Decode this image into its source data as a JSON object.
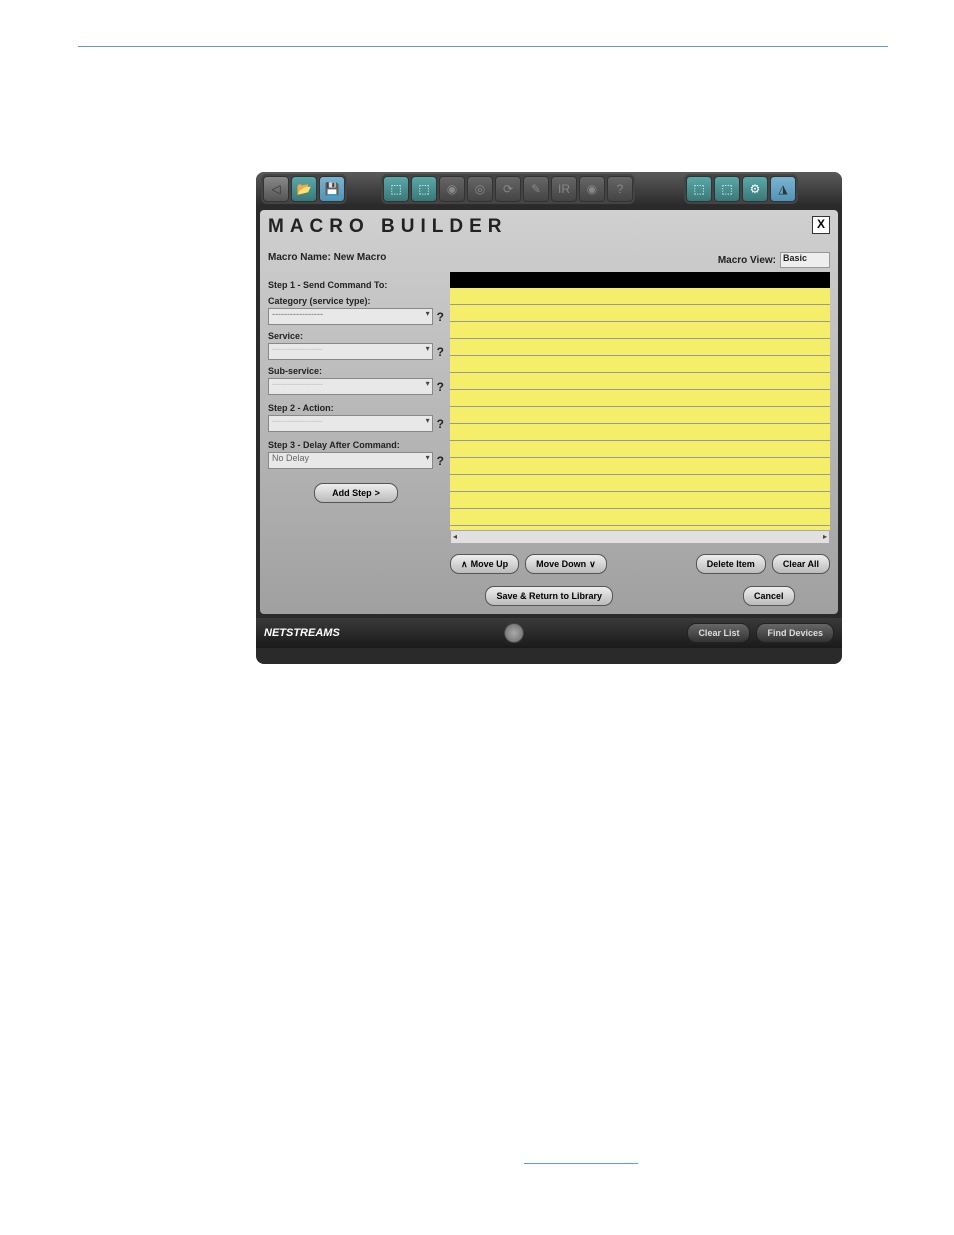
{
  "panel": {
    "title": "MACRO BUILDER",
    "close": "X",
    "macro_name_label": "Macro Name: New Macro",
    "macro_view_label": "Macro View:",
    "macro_view_value": "Basic"
  },
  "steps": {
    "step1": "Step 1 - Send Command To:",
    "category": "Category (service type):",
    "category_value": "-----------------",
    "service": "Service:",
    "service_value": "-----------------",
    "subservice": "Sub-service:",
    "subservice_value": "-----------------",
    "step2": "Step 2 - Action:",
    "action_value": "-----------------",
    "step3": "Step 3 - Delay After Command:",
    "delay_value": "No Delay",
    "add_step": "Add Step",
    "help": "?"
  },
  "list_buttons": {
    "move_up": "Move Up",
    "move_down": "Move Down",
    "delete_item": "Delete Item",
    "clear_all": "Clear All"
  },
  "bottom": {
    "save": "Save & Return to Library",
    "cancel": "Cancel"
  },
  "status": {
    "logo": "NETSTREAMS",
    "clear_list": "Clear List",
    "find_devices": "Find Devices"
  }
}
